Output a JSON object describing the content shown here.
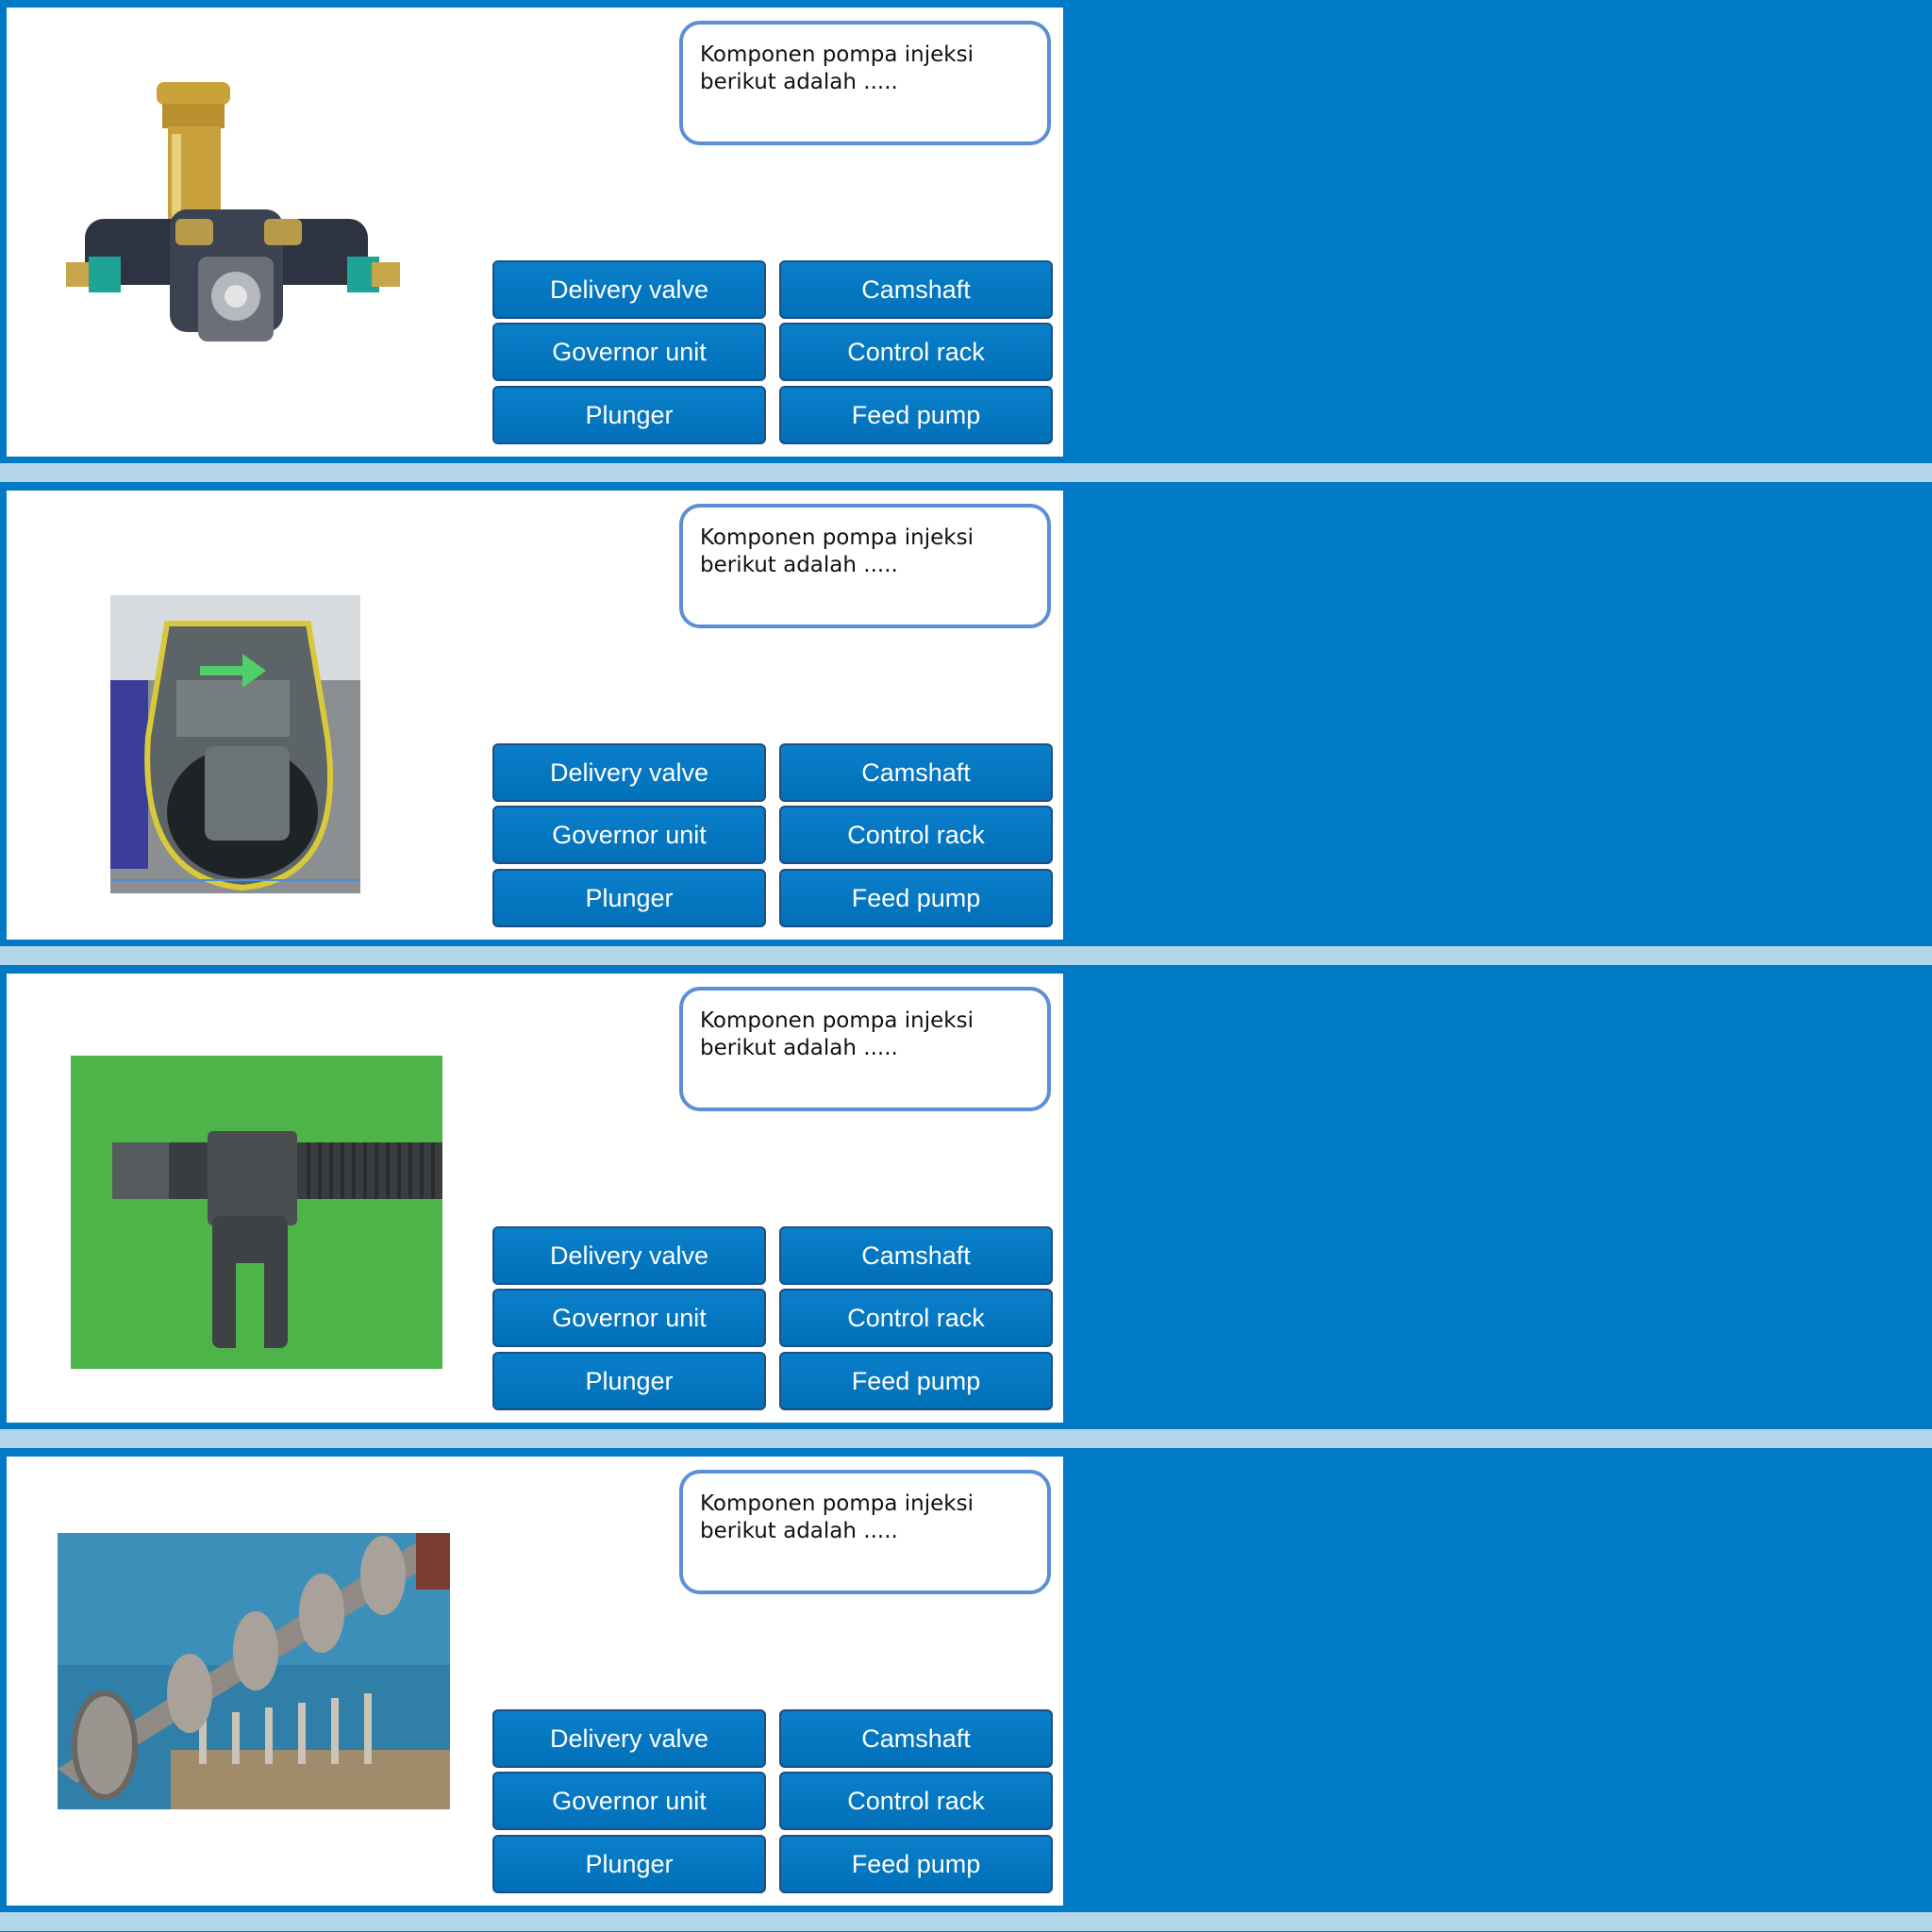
{
  "slides": [
    {
      "question": "Komponen pompa injeksi berikut adalah .....",
      "image_icon": "feed-pump-photo",
      "options": [
        "Delivery valve",
        "Camshaft",
        "Governor unit",
        "Control rack",
        "Plunger",
        "Feed pump"
      ]
    },
    {
      "question": "Komponen pompa injeksi berikut adalah .....",
      "image_icon": "governor-housing-photo",
      "options": [
        "Delivery valve",
        "Camshaft",
        "Governor unit",
        "Control rack",
        "Plunger",
        "Feed pump"
      ]
    },
    {
      "question": "Komponen pompa injeksi berikut adalah .....",
      "image_icon": "control-rack-photo",
      "options": [
        "Delivery valve",
        "Camshaft",
        "Governor unit",
        "Control rack",
        "Plunger",
        "Feed pump"
      ]
    },
    {
      "question": "Komponen pompa injeksi berikut adalah .....",
      "image_icon": "camshaft-photo",
      "options": [
        "Delivery valve",
        "Camshaft",
        "Governor unit",
        "Control rack",
        "Plunger",
        "Feed pump"
      ]
    }
  ],
  "colors": {
    "background": "#007ac4",
    "band": "#b4d6ea",
    "button": "#0a7cc6",
    "question_border": "#5b8fd6"
  }
}
